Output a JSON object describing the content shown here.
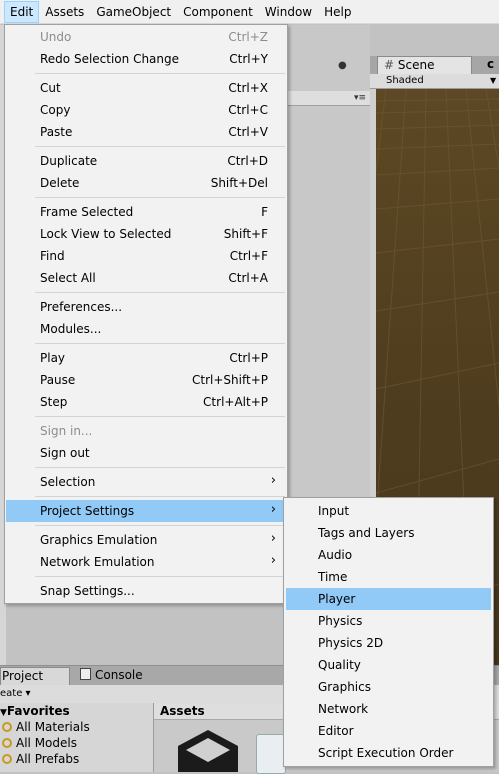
{
  "menubar": {
    "items": [
      {
        "label": "Edit"
      },
      {
        "label": "Assets"
      },
      {
        "label": "GameObject"
      },
      {
        "label": "Component"
      },
      {
        "label": "Window"
      },
      {
        "label": "Help"
      }
    ],
    "active_index": 0
  },
  "edit_menu": {
    "undo": {
      "label": "Undo",
      "shortcut": "Ctrl+Z",
      "enabled": false
    },
    "redo": {
      "label": "Redo Selection Change",
      "shortcut": "Ctrl+Y"
    },
    "cut": {
      "label": "Cut",
      "shortcut": "Ctrl+X"
    },
    "copy": {
      "label": "Copy",
      "shortcut": "Ctrl+C"
    },
    "paste": {
      "label": "Paste",
      "shortcut": "Ctrl+V"
    },
    "duplicate": {
      "label": "Duplicate",
      "shortcut": "Ctrl+D"
    },
    "delete": {
      "label": "Delete",
      "shortcut": "Shift+Del"
    },
    "frame_selected": {
      "label": "Frame Selected",
      "shortcut": "F"
    },
    "lock_view": {
      "label": "Lock View to Selected",
      "shortcut": "Shift+F"
    },
    "find": {
      "label": "Find",
      "shortcut": "Ctrl+F"
    },
    "select_all": {
      "label": "Select All",
      "shortcut": "Ctrl+A"
    },
    "preferences": {
      "label": "Preferences..."
    },
    "modules": {
      "label": "Modules..."
    },
    "play": {
      "label": "Play",
      "shortcut": "Ctrl+P"
    },
    "pause": {
      "label": "Pause",
      "shortcut": "Ctrl+Shift+P"
    },
    "step": {
      "label": "Step",
      "shortcut": "Ctrl+Alt+P"
    },
    "sign_in": {
      "label": "Sign in...",
      "enabled": false
    },
    "sign_out": {
      "label": "Sign out"
    },
    "selection": {
      "label": "Selection"
    },
    "project_settings": {
      "label": "Project Settings",
      "highlighted": true
    },
    "graphics_emulation": {
      "label": "Graphics Emulation"
    },
    "network_emulation": {
      "label": "Network Emulation"
    },
    "snap_settings": {
      "label": "Snap Settings..."
    },
    "submenu_arrow": "›"
  },
  "project_settings_submenu": {
    "items": [
      {
        "label": "Input"
      },
      {
        "label": "Tags and Layers"
      },
      {
        "label": "Audio"
      },
      {
        "label": "Time"
      },
      {
        "label": "Player"
      },
      {
        "label": "Physics"
      },
      {
        "label": "Physics 2D"
      },
      {
        "label": "Quality"
      },
      {
        "label": "Graphics"
      },
      {
        "label": "Network"
      },
      {
        "label": "Editor"
      },
      {
        "label": "Script Execution Order"
      }
    ],
    "highlighted_index": 4
  },
  "scene_panel": {
    "tab_label": "Scene",
    "tab_icon": "#",
    "shading_mode": "Shaded"
  },
  "bottom_panel": {
    "project_tab": "Project",
    "console_tab": "Console",
    "create_button": "eate",
    "favorites_title": "Favorites",
    "favorites": [
      "All Materials",
      "All Models",
      "All Prefabs"
    ],
    "assets_title": "Assets"
  },
  "colors": {
    "highlight": "#91c9f7",
    "menu_bg": "#f2f2f2",
    "scene_ground": "#5a4622"
  }
}
